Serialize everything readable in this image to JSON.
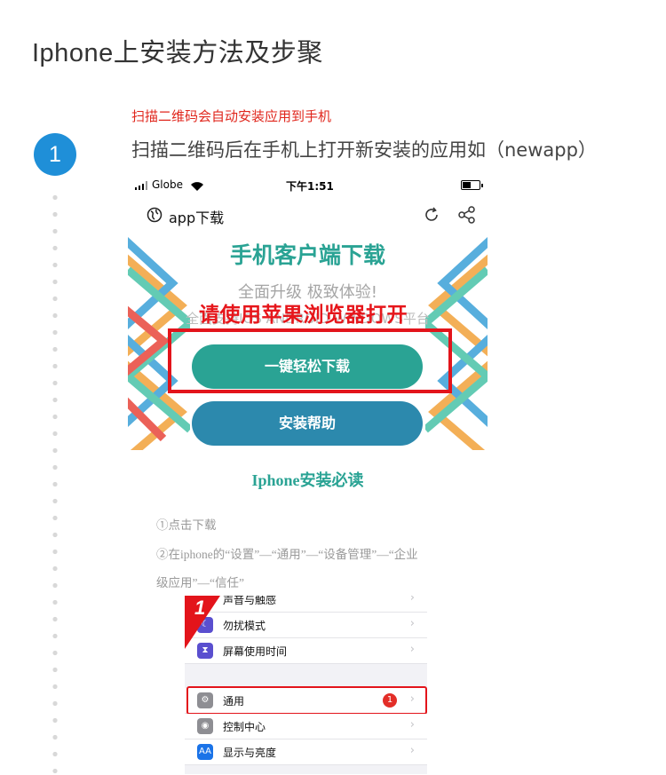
{
  "page": {
    "title": "Iphone上安装方法及步聚"
  },
  "step": {
    "number": "1",
    "note": "扫描二维码会自动安装应用到手机",
    "title": "扫描二维码后在手机上打开新安装的应用如（newapp）"
  },
  "phone": {
    "status": {
      "carrier": "Globe",
      "time": "下午1:51"
    },
    "nav": {
      "title": "app下载"
    },
    "banner": {
      "title": "手机客户端下载",
      "subtitle": "全面升级 极致体验!",
      "support": "全面支持IOS ANDROID WINDOWS平台",
      "overlay": "请使用苹果浏览器打开",
      "download_button": "一键轻松下载",
      "help_button": "安装帮助"
    },
    "guide": {
      "title": "Iphone安装必读",
      "step1": "①点击下载",
      "step2_line1": "②在iphone的“设置”—“通用”—“设备管理”—“企业",
      "step2_line2": "级应用”—“信任”"
    },
    "settings": {
      "corner_number": "1",
      "rows": [
        {
          "label": "声音与触感",
          "icon": "speaker-icon",
          "color": "#e8455a"
        },
        {
          "label": "勿扰模式",
          "icon": "moon-icon",
          "color": "#5a4fcf"
        },
        {
          "label": "屏幕使用时间",
          "icon": "hourglass-icon",
          "color": "#5a4fcf"
        },
        {
          "label": "通用",
          "icon": "gear-icon",
          "color": "#8e8e93",
          "badge": "1"
        },
        {
          "label": "控制中心",
          "icon": "toggle-icon",
          "color": "#8e8e93"
        },
        {
          "label": "显示与亮度",
          "icon": "brightness-icon",
          "color": "#1a73e8",
          "icon_text": "AA"
        }
      ]
    }
  },
  "colors": {
    "accent_blue": "#1f8fd8",
    "note_red": "#e0261c",
    "teal": "#2aa394",
    "button_blue": "#2c89ad",
    "highlight_red": "#e3141b"
  }
}
